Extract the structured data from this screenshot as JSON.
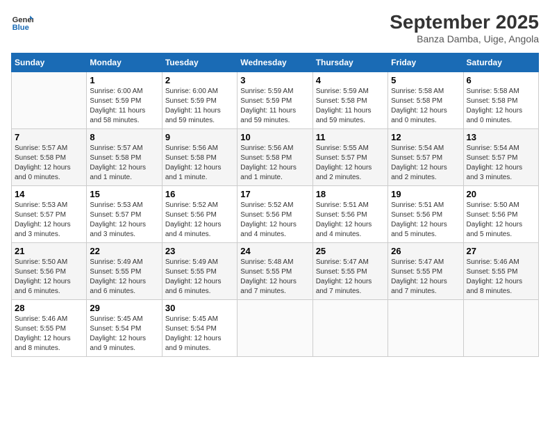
{
  "header": {
    "logo_line1": "General",
    "logo_line2": "Blue",
    "month_title": "September 2025",
    "location": "Banza Damba, Uige, Angola"
  },
  "days_of_week": [
    "Sunday",
    "Monday",
    "Tuesday",
    "Wednesday",
    "Thursday",
    "Friday",
    "Saturday"
  ],
  "weeks": [
    [
      {
        "day": "",
        "info": ""
      },
      {
        "day": "1",
        "info": "Sunrise: 6:00 AM\nSunset: 5:59 PM\nDaylight: 11 hours\nand 58 minutes."
      },
      {
        "day": "2",
        "info": "Sunrise: 6:00 AM\nSunset: 5:59 PM\nDaylight: 11 hours\nand 59 minutes."
      },
      {
        "day": "3",
        "info": "Sunrise: 5:59 AM\nSunset: 5:59 PM\nDaylight: 11 hours\nand 59 minutes."
      },
      {
        "day": "4",
        "info": "Sunrise: 5:59 AM\nSunset: 5:58 PM\nDaylight: 11 hours\nand 59 minutes."
      },
      {
        "day": "5",
        "info": "Sunrise: 5:58 AM\nSunset: 5:58 PM\nDaylight: 12 hours\nand 0 minutes."
      },
      {
        "day": "6",
        "info": "Sunrise: 5:58 AM\nSunset: 5:58 PM\nDaylight: 12 hours\nand 0 minutes."
      }
    ],
    [
      {
        "day": "7",
        "info": "Sunrise: 5:57 AM\nSunset: 5:58 PM\nDaylight: 12 hours\nand 0 minutes."
      },
      {
        "day": "8",
        "info": "Sunrise: 5:57 AM\nSunset: 5:58 PM\nDaylight: 12 hours\nand 1 minute."
      },
      {
        "day": "9",
        "info": "Sunrise: 5:56 AM\nSunset: 5:58 PM\nDaylight: 12 hours\nand 1 minute."
      },
      {
        "day": "10",
        "info": "Sunrise: 5:56 AM\nSunset: 5:58 PM\nDaylight: 12 hours\nand 1 minute."
      },
      {
        "day": "11",
        "info": "Sunrise: 5:55 AM\nSunset: 5:57 PM\nDaylight: 12 hours\nand 2 minutes."
      },
      {
        "day": "12",
        "info": "Sunrise: 5:54 AM\nSunset: 5:57 PM\nDaylight: 12 hours\nand 2 minutes."
      },
      {
        "day": "13",
        "info": "Sunrise: 5:54 AM\nSunset: 5:57 PM\nDaylight: 12 hours\nand 3 minutes."
      }
    ],
    [
      {
        "day": "14",
        "info": "Sunrise: 5:53 AM\nSunset: 5:57 PM\nDaylight: 12 hours\nand 3 minutes."
      },
      {
        "day": "15",
        "info": "Sunrise: 5:53 AM\nSunset: 5:57 PM\nDaylight: 12 hours\nand 3 minutes."
      },
      {
        "day": "16",
        "info": "Sunrise: 5:52 AM\nSunset: 5:56 PM\nDaylight: 12 hours\nand 4 minutes."
      },
      {
        "day": "17",
        "info": "Sunrise: 5:52 AM\nSunset: 5:56 PM\nDaylight: 12 hours\nand 4 minutes."
      },
      {
        "day": "18",
        "info": "Sunrise: 5:51 AM\nSunset: 5:56 PM\nDaylight: 12 hours\nand 4 minutes."
      },
      {
        "day": "19",
        "info": "Sunrise: 5:51 AM\nSunset: 5:56 PM\nDaylight: 12 hours\nand 5 minutes."
      },
      {
        "day": "20",
        "info": "Sunrise: 5:50 AM\nSunset: 5:56 PM\nDaylight: 12 hours\nand 5 minutes."
      }
    ],
    [
      {
        "day": "21",
        "info": "Sunrise: 5:50 AM\nSunset: 5:56 PM\nDaylight: 12 hours\nand 6 minutes."
      },
      {
        "day": "22",
        "info": "Sunrise: 5:49 AM\nSunset: 5:55 PM\nDaylight: 12 hours\nand 6 minutes."
      },
      {
        "day": "23",
        "info": "Sunrise: 5:49 AM\nSunset: 5:55 PM\nDaylight: 12 hours\nand 6 minutes."
      },
      {
        "day": "24",
        "info": "Sunrise: 5:48 AM\nSunset: 5:55 PM\nDaylight: 12 hours\nand 7 minutes."
      },
      {
        "day": "25",
        "info": "Sunrise: 5:47 AM\nSunset: 5:55 PM\nDaylight: 12 hours\nand 7 minutes."
      },
      {
        "day": "26",
        "info": "Sunrise: 5:47 AM\nSunset: 5:55 PM\nDaylight: 12 hours\nand 7 minutes."
      },
      {
        "day": "27",
        "info": "Sunrise: 5:46 AM\nSunset: 5:55 PM\nDaylight: 12 hours\nand 8 minutes."
      }
    ],
    [
      {
        "day": "28",
        "info": "Sunrise: 5:46 AM\nSunset: 5:55 PM\nDaylight: 12 hours\nand 8 minutes."
      },
      {
        "day": "29",
        "info": "Sunrise: 5:45 AM\nSunset: 5:54 PM\nDaylight: 12 hours\nand 9 minutes."
      },
      {
        "day": "30",
        "info": "Sunrise: 5:45 AM\nSunset: 5:54 PM\nDaylight: 12 hours\nand 9 minutes."
      },
      {
        "day": "",
        "info": ""
      },
      {
        "day": "",
        "info": ""
      },
      {
        "day": "",
        "info": ""
      },
      {
        "day": "",
        "info": ""
      }
    ]
  ]
}
